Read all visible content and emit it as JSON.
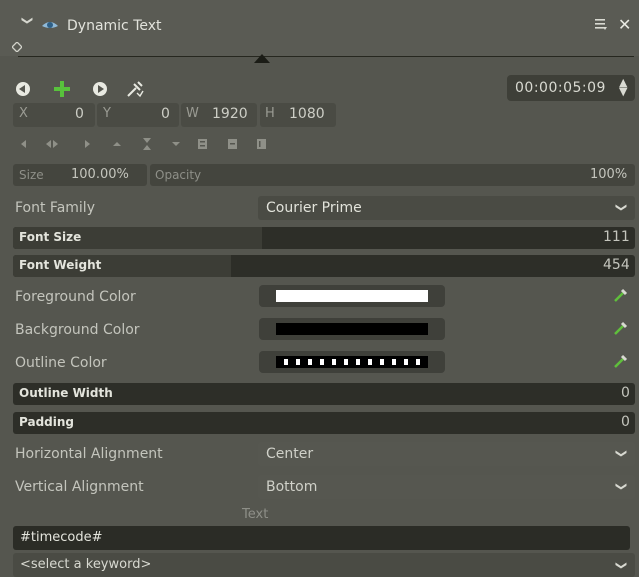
{
  "panel": {
    "title": "Dynamic Text"
  },
  "toolbar": {
    "timecode": "00:00:05:09"
  },
  "geometry": {
    "x_label": "X",
    "x_value": "0",
    "y_label": "Y",
    "y_value": "0",
    "w_label": "W",
    "w_value": "1920",
    "h_label": "H",
    "h_value": "1080"
  },
  "transform": {
    "size_label": "Size",
    "size_value": "100.00%",
    "opacity_label": "Opacity",
    "opacity_value": "100%"
  },
  "font_family": {
    "label": "Font Family",
    "value": "Courier Prime"
  },
  "font_size": {
    "label": "Font Size",
    "value": "111",
    "fill_fraction": 0.4
  },
  "font_weight": {
    "label": "Font Weight",
    "value": "454",
    "fill_fraction": 0.35
  },
  "foreground": {
    "label": "Foreground Color",
    "color": "#ffffff"
  },
  "background": {
    "label": "Background Color",
    "color": "#000000"
  },
  "outline": {
    "label": "Outline Color",
    "color": "transparent"
  },
  "outline_width": {
    "label": "Outline Width",
    "value": "0"
  },
  "padding": {
    "label": "Padding",
    "value": "0"
  },
  "h_align": {
    "label": "Horizontal Alignment",
    "value": "Center"
  },
  "v_align": {
    "label": "Vertical Alignment",
    "value": "Bottom"
  },
  "text_section": {
    "header": "Text",
    "value": "#timecode#",
    "keyword_placeholder": "<select a keyword>"
  },
  "colors": {
    "accent_green": "#58c23c",
    "picker_green": "#5fbf3b"
  }
}
